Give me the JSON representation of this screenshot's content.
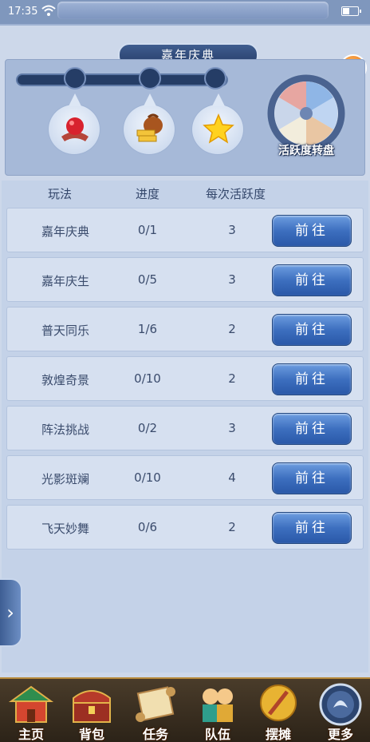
{
  "status_bar": {
    "time": "17:35"
  },
  "window": {
    "title": "嘉年庆典",
    "close_label": "×"
  },
  "rewards": [
    {
      "icon": "red-ball-icon"
    },
    {
      "icon": "gold-bag-icon"
    },
    {
      "icon": "star-icon"
    }
  ],
  "wheel": {
    "label": "活跃度转盘",
    "icon": "wheel-icon"
  },
  "table": {
    "headers": {
      "name": "玩法",
      "progress": "进度",
      "points": "每次活跃度"
    },
    "rows": [
      {
        "name": "嘉年庆典",
        "progress": "0/1",
        "points": "3",
        "action": "前往"
      },
      {
        "name": "嘉年庆生",
        "progress": "0/5",
        "points": "3",
        "action": "前往"
      },
      {
        "name": "普天同乐",
        "progress": "1/6",
        "points": "2",
        "action": "前往"
      },
      {
        "name": "敦煌奇景",
        "progress": "0/10",
        "points": "2",
        "action": "前往"
      },
      {
        "name": "阵法挑战",
        "progress": "0/2",
        "points": "3",
        "action": "前往"
      },
      {
        "name": "光影斑斓",
        "progress": "0/10",
        "points": "4",
        "action": "前往"
      },
      {
        "name": "飞天妙舞",
        "progress": "0/6",
        "points": "2",
        "action": "前往"
      }
    ]
  },
  "side_tab": {
    "label": "›"
  },
  "bottom_nav": [
    {
      "label": "主页",
      "icon": "home-icon"
    },
    {
      "label": "背包",
      "icon": "bag-icon"
    },
    {
      "label": "任务",
      "icon": "scroll-icon"
    },
    {
      "label": "队伍",
      "icon": "team-icon"
    },
    {
      "label": "摆摊",
      "icon": "stall-icon"
    },
    {
      "label": "更多",
      "icon": "more-icon"
    }
  ],
  "colors": {
    "accent": "#3d6fbf",
    "close": "#e26b12",
    "panel": "#cdd8ea"
  }
}
